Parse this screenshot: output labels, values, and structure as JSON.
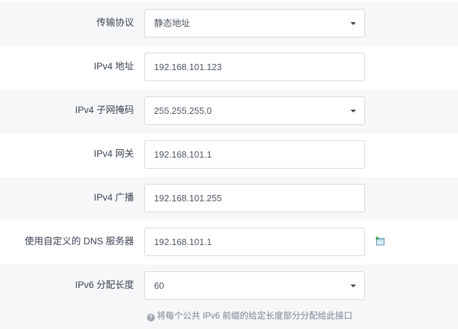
{
  "fields": {
    "protocol": {
      "label": "传输协议",
      "value": "静态地址"
    },
    "ipv4_address": {
      "label": "IPv4 地址",
      "value": "192.168.101.123"
    },
    "ipv4_netmask": {
      "label": "IPv4 子网掩码",
      "value": "255.255.255.0"
    },
    "ipv4_gateway": {
      "label": "IPv4 网关",
      "value": "192.168.101.1"
    },
    "ipv4_broadcast": {
      "label": "IPv4 广播",
      "value": "192.168.101.255"
    },
    "custom_dns": {
      "label": "使用自定义的 DNS 服务器",
      "value": "192.168.101.1"
    },
    "ipv6_assign_length": {
      "label": "IPv6 分配长度",
      "value": "60",
      "help": "将每个公共 IPv6 前缀的给定长度部分分配给此接口"
    }
  },
  "icons": {
    "add_dns": "add-entry-icon",
    "help": "question-circle-icon"
  }
}
